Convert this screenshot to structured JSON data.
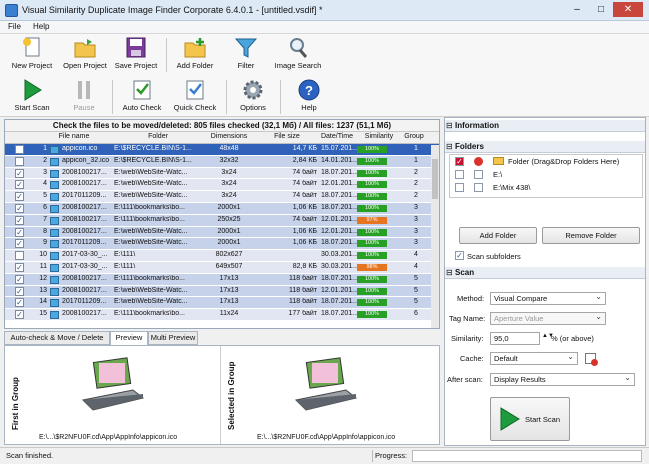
{
  "window": {
    "title": "Visual Similarity Duplicate Image Finder Corporate 6.4.0.1 - [untitled.vsdif] *"
  },
  "menu": [
    "File",
    "Help"
  ],
  "toolbar_top": [
    {
      "label": "New Project",
      "icon": "new-project-icon"
    },
    {
      "label": "Open Project",
      "icon": "open-folder-icon"
    },
    {
      "label": "Save Project",
      "icon": "floppy-disk-icon"
    },
    {
      "label": "Add Folder",
      "icon": "add-folder-icon"
    },
    {
      "label": "Filter",
      "icon": "funnel-icon"
    },
    {
      "label": "Image Search",
      "icon": "magnifier-icon"
    }
  ],
  "toolbar_bottom": [
    {
      "label": "Start Scan",
      "icon": "play-icon"
    },
    {
      "label": "Pause",
      "icon": "pause-icon"
    },
    {
      "label": "Auto Check",
      "icon": "auto-check-icon"
    },
    {
      "label": "Quick Check",
      "icon": "quick-check-icon"
    },
    {
      "label": "Options",
      "icon": "gear-icon"
    },
    {
      "label": "Help",
      "icon": "help-icon"
    }
  ],
  "grid": {
    "title": "Check the files to be moved/deleted: 805 files checked (32,1 Мб) / All files: 1237 (51,1 Мб)",
    "columns": [
      "File name",
      "Folder",
      "Dimensions",
      "File size",
      "Date/Time",
      "Similarity",
      "Group"
    ],
    "rows": [
      {
        "num": "1",
        "name": "appicon.ico",
        "folder": "E:\\$RECYCLE.BIN\\S-1...",
        "dim": "48x48",
        "size": "14,7 КБ",
        "date": "15.07.201...",
        "sim": "100%",
        "group": "1",
        "checked": false
      },
      {
        "num": "2",
        "name": "appicon_32.ico",
        "folder": "E:\\$RECYCLE.BIN\\S-1...",
        "dim": "32x32",
        "size": "2,84 КБ",
        "date": "14.01.201...",
        "sim": "100%",
        "group": "1",
        "checked": false
      },
      {
        "num": "3",
        "name": "2008100217...",
        "folder": "E:\\web\\WebSite-Watc...",
        "dim": "3x24",
        "size": "74 байт",
        "date": "18.07.201...",
        "sim": "100%",
        "group": "2",
        "checked": true
      },
      {
        "num": "4",
        "name": "2008100217...",
        "folder": "E:\\web\\WebSite-Watc...",
        "dim": "3x24",
        "size": "74 байт",
        "date": "12.01.201...",
        "sim": "100%",
        "group": "2",
        "checked": true
      },
      {
        "num": "5",
        "name": "2017011209...",
        "folder": "E:\\web\\WebSite-Watc...",
        "dim": "3x24",
        "size": "74 байт",
        "date": "18.07.201...",
        "sim": "100%",
        "group": "2",
        "checked": true
      },
      {
        "num": "6",
        "name": "2008100217...",
        "folder": "E:\\111\\bookmarks\\bo...",
        "dim": "2000x1",
        "size": "1,06 КБ",
        "date": "18.07.201...",
        "sim": "100%",
        "group": "3",
        "checked": true
      },
      {
        "num": "7",
        "name": "2008100217...",
        "folder": "E:\\111\\bookmarks\\bo...",
        "dim": "250x25",
        "size": "74 байт",
        "date": "12.01.201...",
        "sim": "97%",
        "group": "3",
        "checked": true
      },
      {
        "num": "8",
        "name": "2008100217...",
        "folder": "E:\\web\\WebSite-Watc...",
        "dim": "2000x1",
        "size": "1,06 КБ",
        "date": "12.01.201...",
        "sim": "100%",
        "group": "3",
        "checked": true
      },
      {
        "num": "9",
        "name": "2017011209...",
        "folder": "E:\\web\\WebSite-Watc...",
        "dim": "2000x1",
        "size": "1,06 КБ",
        "date": "18.07.201...",
        "sim": "100%",
        "group": "3",
        "checked": true
      },
      {
        "num": "10",
        "name": "2017-03-30_...",
        "folder": "E:\\111\\",
        "dim": "802x627",
        "size": "",
        "date": "30.03.201...",
        "sim": "100%",
        "group": "4",
        "checked": false
      },
      {
        "num": "11",
        "name": "2017-03-30_...",
        "folder": "E:\\111\\",
        "dim": "649x507",
        "size": "82,8 КБ",
        "date": "30.03.201...",
        "sim": "98%",
        "group": "4",
        "checked": true
      },
      {
        "num": "12",
        "name": "2008100217...",
        "folder": "E:\\111\\bookmarks\\bo...",
        "dim": "17x13",
        "size": "118 байт",
        "date": "18.07.201...",
        "sim": "100%",
        "group": "5",
        "checked": true
      },
      {
        "num": "13",
        "name": "2008100217...",
        "folder": "E:\\web\\WebSite-Watc...",
        "dim": "17x13",
        "size": "118 байт",
        "date": "12.01.201...",
        "sim": "100%",
        "group": "5",
        "checked": true
      },
      {
        "num": "14",
        "name": "2017011209...",
        "folder": "E:\\web\\WebSite-Watc...",
        "dim": "17x13",
        "size": "118 байт",
        "date": "18.07.201...",
        "sim": "100%",
        "group": "5",
        "checked": true
      },
      {
        "num": "15",
        "name": "2008100217...",
        "folder": "E:\\111\\bookmarks\\bo...",
        "dim": "11x24",
        "size": "177 байт",
        "date": "18.07.201...",
        "sim": "100%",
        "group": "6",
        "checked": true
      }
    ]
  },
  "tabs": [
    "Auto-check & Move / Delete",
    "Preview",
    "Multi Preview"
  ],
  "preview": {
    "left_label": "First in Group",
    "right_label": "Selected in Group",
    "left_caption": "E:\\...\\$R2NFU0F.cd\\App\\AppInfo\\appicon.ico",
    "right_caption": "E:\\...\\$R2NFU0F.cd\\App\\AppInfo\\appicon.ico"
  },
  "right_panel": {
    "information_title": "Information",
    "folders_title": "Folders",
    "folder_header": "Folder (Drag&Drop Folders Here)",
    "folders": [
      "E:\\",
      "E:\\Mix  438\\"
    ],
    "add_folder": "Add Folder",
    "remove_folder": "Remove Folder",
    "scan_subfolders": "Scan subfolders",
    "scan_title": "Scan",
    "method_label": "Method:",
    "method_value": "Visual Compare",
    "tagname_label": "Tag Name:",
    "tagname_value": "Aperture Value",
    "similarity_label": "Similarity:",
    "similarity_value": "95,0",
    "similarity_unit": "% (or above)",
    "cache_label": "Cache:",
    "cache_value": "Default",
    "afterscan_label": "After scan:",
    "afterscan_value": "Display Results",
    "start_scan": "Start Scan"
  },
  "status": {
    "text": "Scan finished.",
    "progress_label": "Progress:"
  },
  "colors": {
    "accent": "#2f62b8",
    "green": "#27a025",
    "orange": "#e5751f"
  }
}
